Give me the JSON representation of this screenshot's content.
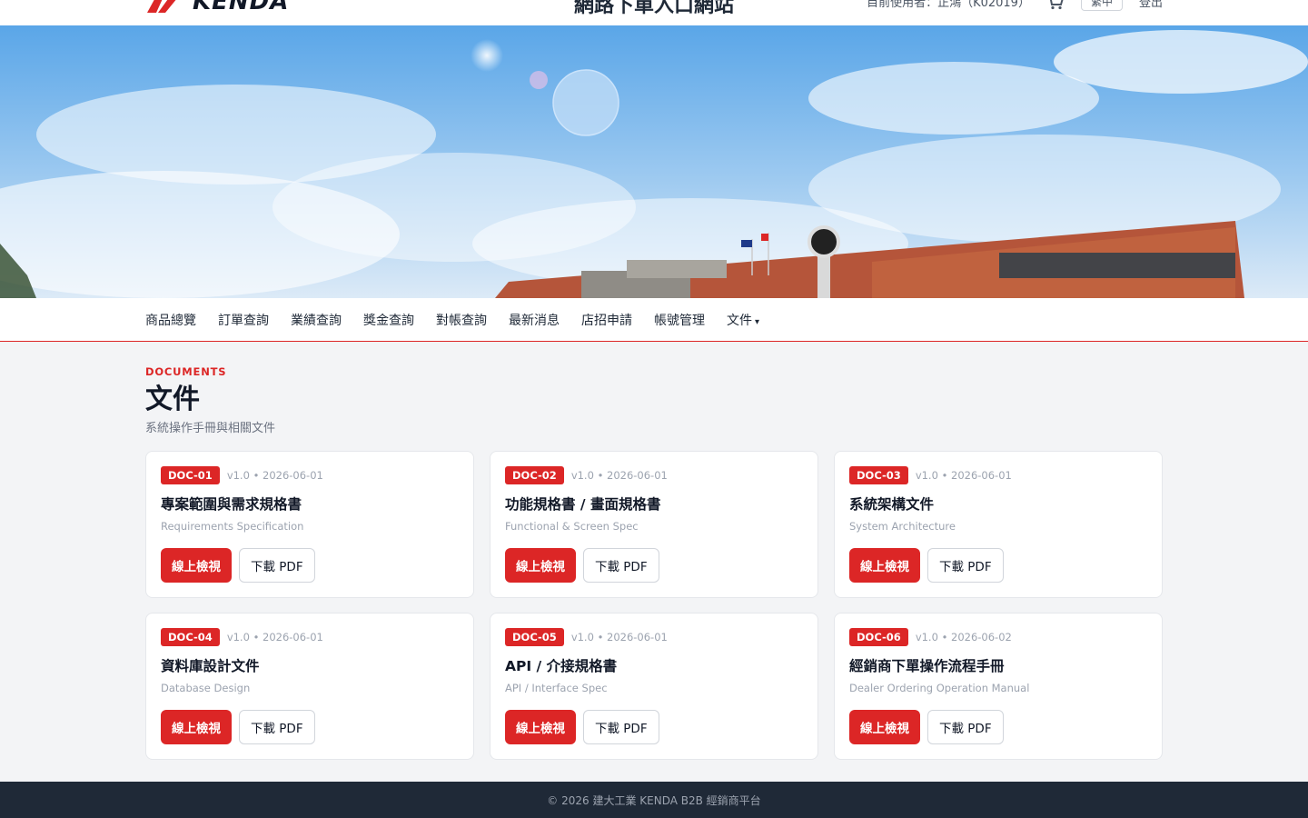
{
  "header": {
    "logo_text": "KENDA",
    "site_title": "網路下單入口網站",
    "user_label": "目前使用者：正鴻（K02019）",
    "lang_button": "繁中",
    "logout_label": "登出"
  },
  "nav": {
    "items": [
      {
        "label": "商品總覽"
      },
      {
        "label": "訂單查詢"
      },
      {
        "label": "業績查詢"
      },
      {
        "label": "獎金查詢"
      },
      {
        "label": "對帳查詢"
      },
      {
        "label": "最新消息"
      },
      {
        "label": "店招申請"
      },
      {
        "label": "帳號管理"
      },
      {
        "label": "文件",
        "caret": "▾"
      }
    ]
  },
  "page": {
    "eyebrow": "DOCUMENTS",
    "title": "文件",
    "subtitle": "系統操作手冊與相關文件"
  },
  "documents": [
    {
      "code": "DOC-01",
      "meta": "v1.0 • 2026-06-01",
      "title": "專案範圍與需求規格書",
      "subtitle": "Requirements Specification",
      "view_label": "線上檢視",
      "download_label": "下載 PDF"
    },
    {
      "code": "DOC-02",
      "meta": "v1.0 • 2026-06-01",
      "title": "功能規格書 / 畫面規格書",
      "subtitle": "Functional & Screen Spec",
      "view_label": "線上檢視",
      "download_label": "下載 PDF"
    },
    {
      "code": "DOC-03",
      "meta": "v1.0 • 2026-06-01",
      "title": "系統架構文件",
      "subtitle": "System Architecture",
      "view_label": "線上檢視",
      "download_label": "下載 PDF"
    },
    {
      "code": "DOC-04",
      "meta": "v1.0 • 2026-06-01",
      "title": "資料庫設計文件",
      "subtitle": "Database Design",
      "view_label": "線上檢視",
      "download_label": "下載 PDF"
    },
    {
      "code": "DOC-05",
      "meta": "v1.0 • 2026-06-01",
      "title": "API / 介接規格書",
      "subtitle": "API / Interface Spec",
      "view_label": "線上檢視",
      "download_label": "下載 PDF"
    },
    {
      "code": "DOC-06",
      "meta": "v1.0 • 2026-06-02",
      "title": "經銷商下單操作流程手冊",
      "subtitle": "Dealer Ordering Operation Manual",
      "view_label": "線上檢視",
      "download_label": "下載 PDF"
    }
  ],
  "footer": {
    "text": "© 2026 建大工業 KENDA B2B 經銷商平台"
  },
  "colors": {
    "accent": "#dc2626",
    "footer_bg": "#1f2937",
    "page_bg": "#f3f4f6"
  }
}
